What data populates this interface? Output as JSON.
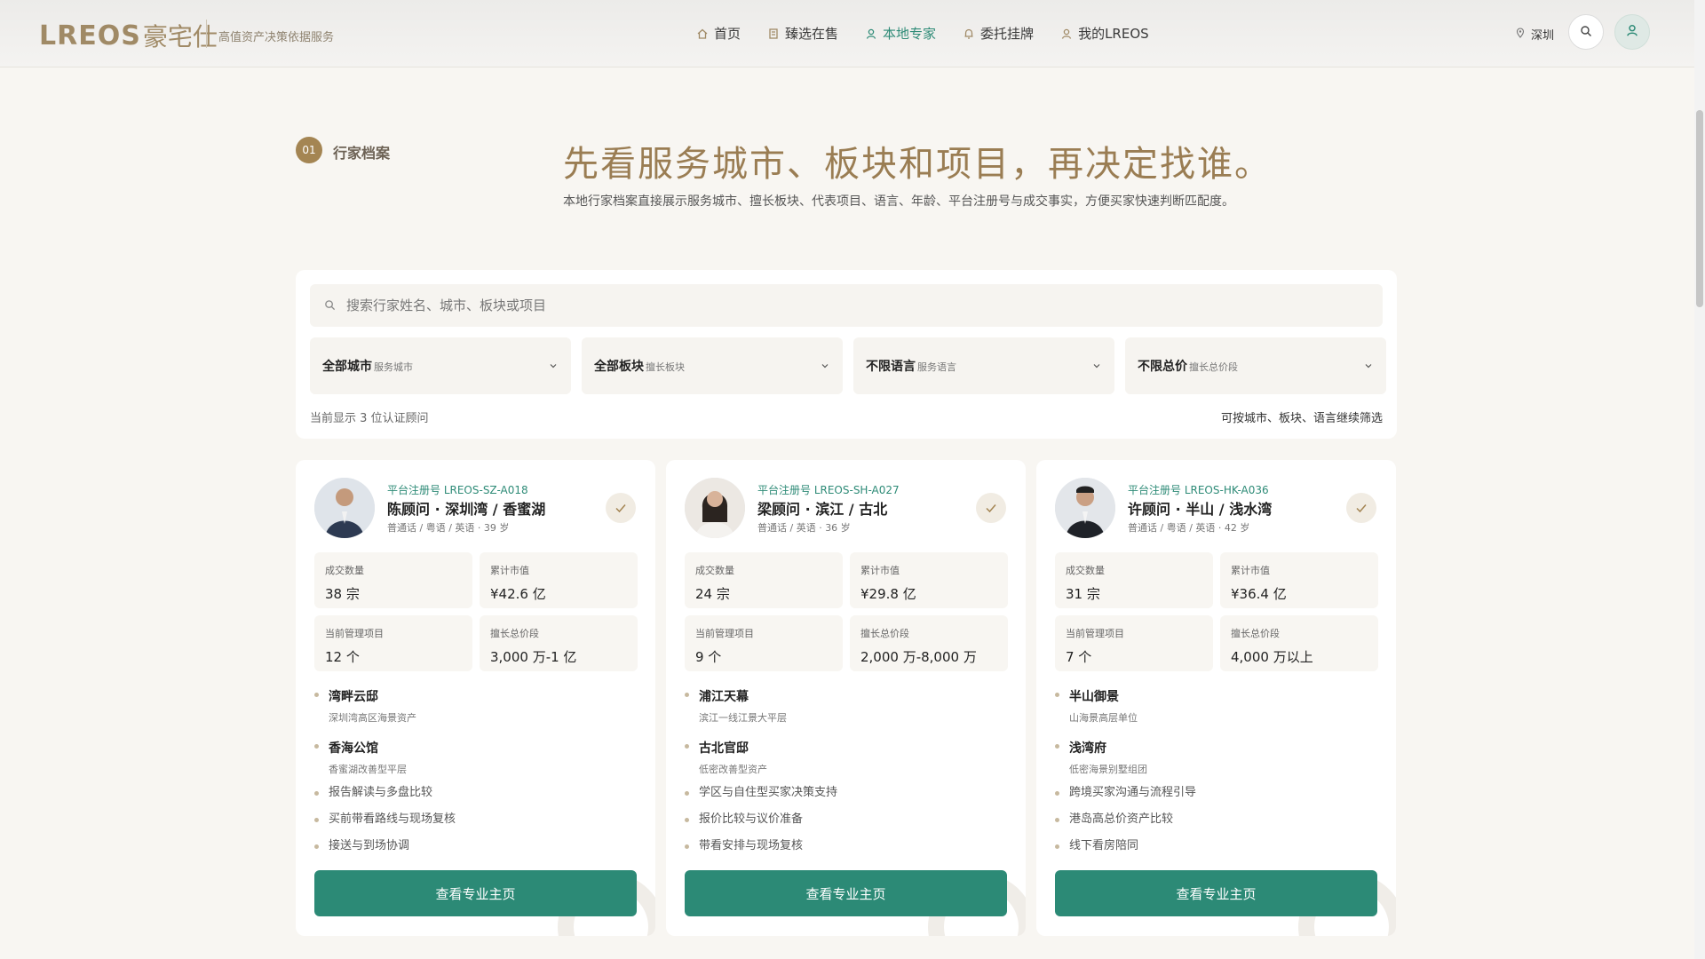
{
  "header": {
    "logo": "LREOS",
    "logo_sub": "豪宅仕",
    "tagline": "高值资产决策依据服务",
    "nav": [
      {
        "label": "首页",
        "icon": "home-icon"
      },
      {
        "label": "臻选在售",
        "icon": "building-icon"
      },
      {
        "label": "本地专家",
        "icon": "user-icon",
        "active": true
      },
      {
        "label": "委托挂牌",
        "icon": "bell-icon"
      },
      {
        "label": "我的LREOS",
        "icon": "user-icon"
      }
    ],
    "city": "深圳"
  },
  "hero": {
    "section_no": "01",
    "section_label": "行家档案",
    "title": "先看服务城市、板块和项目，再决定找谁。",
    "description": "本地行家档案直接展示服务城市、擅长板块、代表项目、语言、年龄、平台注册号与成交事实，方便买家快速判断匹配度。"
  },
  "filters": {
    "search_placeholder": "搜索行家姓名、城市、板块或项目",
    "selects": [
      {
        "value": "全部城市",
        "hint": "服务城市"
      },
      {
        "value": "全部板块",
        "hint": "擅长板块"
      },
      {
        "value": "不限语言",
        "hint": "服务语言"
      },
      {
        "value": "不限总价",
        "hint": "擅长总价段"
      }
    ],
    "count_text": "当前显示 3 位认证顾问",
    "tip_text": "可按城市、板块、语言继续筛选"
  },
  "stat_labels": [
    "成交数量",
    "累计市值",
    "当前管理项目",
    "擅长总价段"
  ],
  "advisors": [
    {
      "reg_no": "平台注册号 LREOS-SZ-A018",
      "name": "陈顾问 · 深圳湾 / 香蜜湖",
      "meta": "普通话 / 粤语 / 英语 · 39 岁",
      "stats": [
        "38 宗",
        "¥42.6 亿",
        "12 个",
        "3,000 万-1 亿"
      ],
      "projects": [
        {
          "name": "湾畔云邸",
          "desc": "深圳湾高区海景资产"
        },
        {
          "name": "香海公馆",
          "desc": "香蜜湖改善型平层"
        }
      ],
      "services": [
        "报告解读与多盘比较",
        "买前带看路线与现场复核",
        "接送与到场协调"
      ],
      "button": "查看专业主页"
    },
    {
      "reg_no": "平台注册号 LREOS-SH-A027",
      "name": "梁顾问 · 滨江 / 古北",
      "meta": "普通话 / 英语 · 36 岁",
      "stats": [
        "24 宗",
        "¥29.8 亿",
        "9 个",
        "2,000 万-8,000 万"
      ],
      "projects": [
        {
          "name": "浦江天幕",
          "desc": "滨江一线江景大平层"
        },
        {
          "name": "古北官邸",
          "desc": "低密改善型资产"
        }
      ],
      "services": [
        "学区与自住型买家决策支持",
        "报价比较与议价准备",
        "带看安排与现场复核"
      ],
      "button": "查看专业主页"
    },
    {
      "reg_no": "平台注册号 LREOS-HK-A036",
      "name": "许顾问 · 半山 / 浅水湾",
      "meta": "普通话 / 粤语 / 英语 · 42 岁",
      "stats": [
        "31 宗",
        "¥36.4 亿",
        "7 个",
        "4,000 万以上"
      ],
      "projects": [
        {
          "name": "半山御景",
          "desc": "山海景高层单位"
        },
        {
          "name": "浅湾府",
          "desc": "低密海景别墅组团"
        }
      ],
      "services": [
        "跨境买家沟通与流程引导",
        "港岛高总价资产比较",
        "线下看房陪同"
      ],
      "button": "查看专业主页"
    }
  ]
}
